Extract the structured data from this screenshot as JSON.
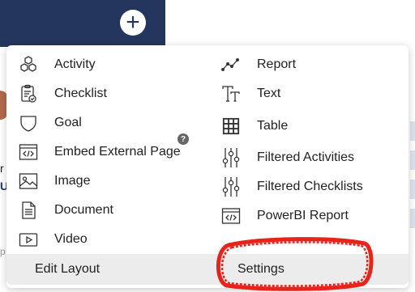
{
  "add_button": "+",
  "background": {
    "text_r": "r",
    "text_u": "U",
    "text_p": "p"
  },
  "menu": {
    "left_items": [
      {
        "label": "Activity",
        "icon": "hexagon-cluster-icon"
      },
      {
        "label": "Checklist",
        "icon": "clipboard-check-icon"
      },
      {
        "label": "Goal",
        "icon": "shield-icon"
      },
      {
        "label": "Embed External Page",
        "icon": "code-window-icon"
      },
      {
        "label": "Image",
        "icon": "image-icon"
      },
      {
        "label": "Document",
        "icon": "document-icon"
      },
      {
        "label": "Video",
        "icon": "video-play-icon"
      }
    ],
    "right_items": [
      {
        "label": "Report",
        "icon": "line-chart-icon"
      },
      {
        "label": "Text",
        "icon": "text-tt-icon"
      },
      {
        "label": "Table",
        "icon": "grid-table-icon"
      },
      {
        "label": "Filtered Activities",
        "icon": "sliders-icon"
      },
      {
        "label": "Filtered Checklists",
        "icon": "sliders-icon"
      },
      {
        "label": "PowerBI Report",
        "icon": "code-window-icon"
      }
    ],
    "help_badge": "?",
    "footer": {
      "edit_layout": "Edit Layout",
      "settings": "Settings"
    }
  },
  "colors": {
    "header": "#24365d",
    "annotation": "#e8231c",
    "footer": "#ececec"
  }
}
